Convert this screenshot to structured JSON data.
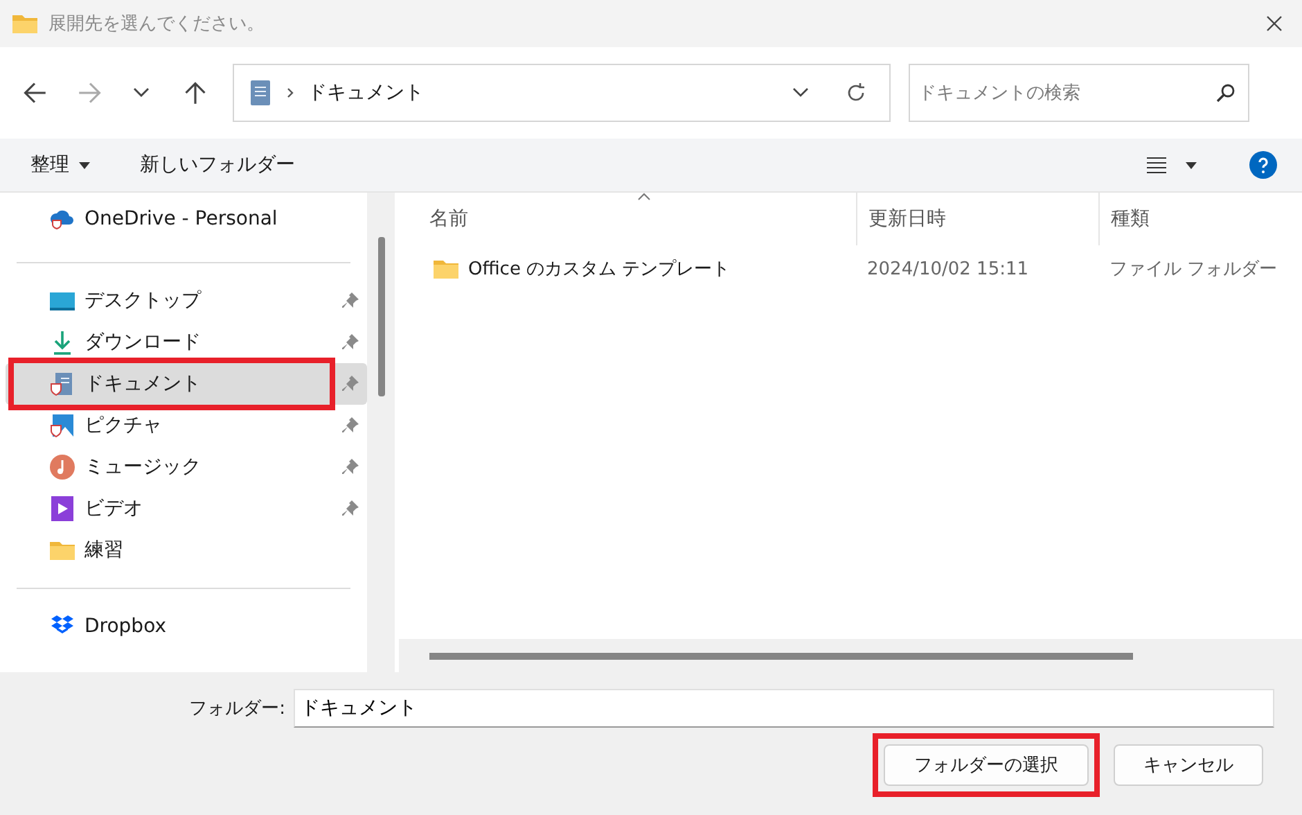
{
  "window": {
    "title": "展開先を選んでください。"
  },
  "address": {
    "location": "ドキュメント"
  },
  "search": {
    "placeholder": "ドキュメントの検索"
  },
  "commands": [
    {
      "label": "整理",
      "dropdown": true
    },
    {
      "label": "新しいフォルダー",
      "dropdown": false
    }
  ],
  "sidebar": {
    "groups": [
      {
        "items": [
          {
            "kind": "onedrive",
            "label": "OneDrive - Personal",
            "pinned": false,
            "selected": false,
            "annotated": false
          }
        ]
      },
      {
        "items": [
          {
            "kind": "desktop",
            "label": "デスクトップ",
            "pinned": true,
            "selected": false,
            "annotated": false
          },
          {
            "kind": "download",
            "label": "ダウンロード",
            "pinned": true,
            "selected": false,
            "annotated": false
          },
          {
            "kind": "documents",
            "label": "ドキュメント",
            "pinned": true,
            "selected": true,
            "annotated": true
          },
          {
            "kind": "pictures",
            "label": "ピクチャ",
            "pinned": true,
            "selected": false,
            "annotated": false
          },
          {
            "kind": "music",
            "label": "ミュージック",
            "pinned": true,
            "selected": false,
            "annotated": false
          },
          {
            "kind": "video",
            "label": "ビデオ",
            "pinned": true,
            "selected": false,
            "annotated": false
          },
          {
            "kind": "folder",
            "label": "練習",
            "pinned": false,
            "selected": false,
            "annotated": false
          }
        ]
      },
      {
        "items": [
          {
            "kind": "dropbox",
            "label": "Dropbox",
            "pinned": false,
            "selected": false,
            "annotated": false
          }
        ]
      }
    ]
  },
  "table": {
    "columns": [
      "名前",
      "更新日時",
      "種類"
    ],
    "rows": [
      {
        "name": "Office のカスタム テンプレート",
        "modified": "2024/10/02 15:11",
        "type": "ファイル フォルダー"
      }
    ]
  },
  "folder_field": {
    "label": "フォルダー:",
    "value": "ドキュメント"
  },
  "buttons": [
    {
      "label": "フォルダーの選択",
      "annotated": true
    },
    {
      "label": "キャンセル",
      "annotated": false
    }
  ]
}
